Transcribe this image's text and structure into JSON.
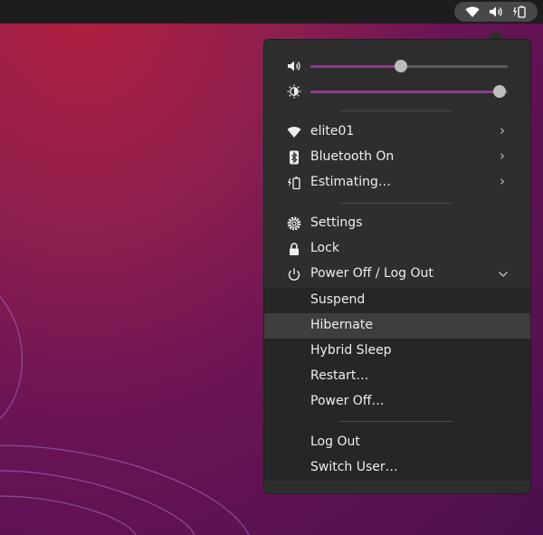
{
  "topbar": {
    "tray_icons": [
      "wifi-icon",
      "volume-icon",
      "battery-icon"
    ]
  },
  "sliders": {
    "volume": {
      "icon": "volume-icon",
      "level": 0.46
    },
    "brightness": {
      "icon": "brightness-icon",
      "level": 0.96
    }
  },
  "network": {
    "label": "elite01",
    "icon": "wifi-icon"
  },
  "bluetooth": {
    "label": "Bluetooth On",
    "icon": "bluetooth-icon"
  },
  "battery": {
    "label": "Estimating…",
    "icon": "battery-icon"
  },
  "settings": {
    "label": "Settings",
    "icon": "gear-icon"
  },
  "lock": {
    "label": "Lock",
    "icon": "lock-icon"
  },
  "power": {
    "label": "Power Off / Log Out",
    "icon": "power-icon",
    "expanded": true,
    "items": [
      "Suspend",
      "Hibernate",
      "Hybrid Sleep",
      "Restart…",
      "Power Off…"
    ],
    "session_items": [
      "Log Out",
      "Switch User…"
    ],
    "highlighted": "Hibernate"
  },
  "colors": {
    "accent": "#8a3f8b",
    "menu_bg": "#2e2e2e",
    "highlight": "#3e3e3e"
  }
}
